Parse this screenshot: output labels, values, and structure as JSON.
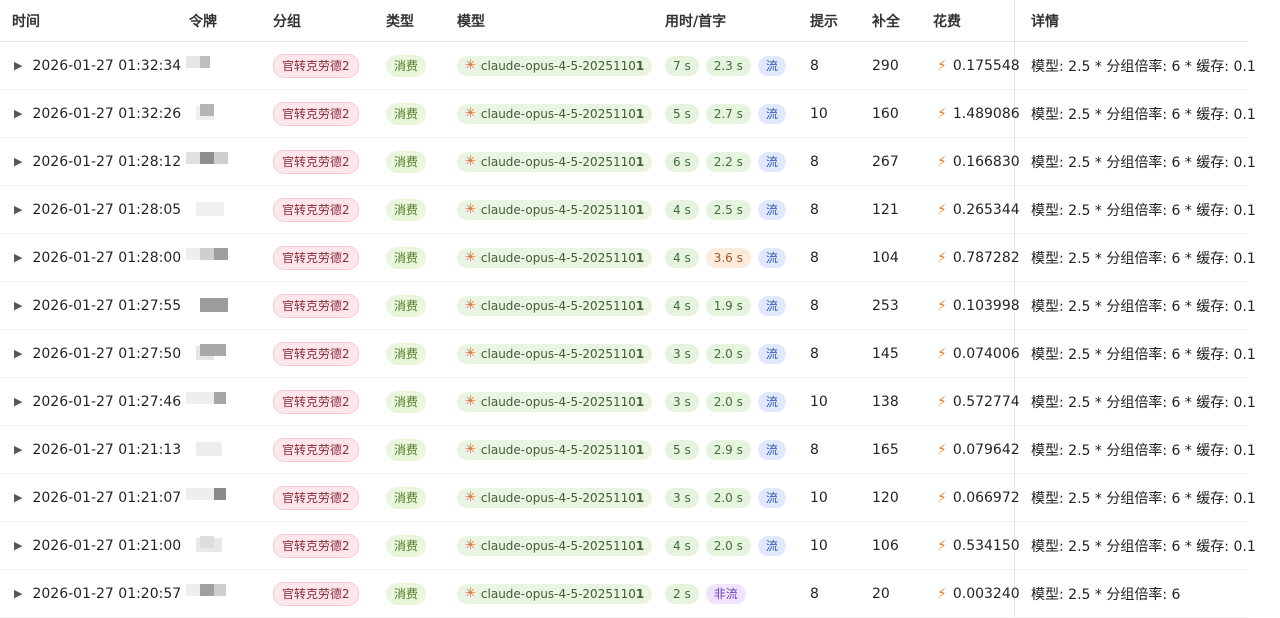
{
  "headers": {
    "time": "时间",
    "token": "令牌",
    "group": "分组",
    "type": "类型",
    "model": "模型",
    "usetime": "用时/首字",
    "prompt": "提示",
    "completion": "补全",
    "cost": "花费",
    "detail": "详情"
  },
  "rows": [
    {
      "time": "2026-01-27 01:32:34",
      "group": "官转克劳德2",
      "type": "消费",
      "model": "claude-opus-4-5-2025110",
      "model_bold": "1",
      "use": "7 s",
      "first": "2.3 s",
      "first_color": "green",
      "stream": "流",
      "prompt": "8",
      "completion": "290",
      "cost": "0.175548",
      "detail": "模型: 2.5 * 分组倍率: 6 * 缓存: 0.1"
    },
    {
      "time": "2026-01-27 01:32:26",
      "group": "官转克劳德2",
      "type": "消费",
      "model": "claude-opus-4-5-2025110",
      "model_bold": "1",
      "use": "5 s",
      "first": "2.7 s",
      "first_color": "green",
      "stream": "流",
      "prompt": "10",
      "completion": "160",
      "cost": "1.489086",
      "detail": "模型: 2.5 * 分组倍率: 6 * 缓存: 0.1"
    },
    {
      "time": "2026-01-27 01:28:12",
      "group": "官转克劳德2",
      "type": "消费",
      "model": "claude-opus-4-5-2025110",
      "model_bold": "1",
      "use": "6 s",
      "first": "2.2 s",
      "first_color": "green",
      "stream": "流",
      "prompt": "8",
      "completion": "267",
      "cost": "0.166830",
      "detail": "模型: 2.5 * 分组倍率: 6 * 缓存: 0.1"
    },
    {
      "time": "2026-01-27 01:28:05",
      "group": "官转克劳德2",
      "type": "消费",
      "model": "claude-opus-4-5-2025110",
      "model_bold": "1",
      "use": "4 s",
      "first": "2.5 s",
      "first_color": "green",
      "stream": "流",
      "prompt": "8",
      "completion": "121",
      "cost": "0.265344",
      "detail": "模型: 2.5 * 分组倍率: 6 * 缓存: 0.1"
    },
    {
      "time": "2026-01-27 01:28:00",
      "group": "官转克劳德2",
      "type": "消费",
      "model": "claude-opus-4-5-2025110",
      "model_bold": "1",
      "use": "4 s",
      "first": "3.6 s",
      "first_color": "orange",
      "stream": "流",
      "prompt": "8",
      "completion": "104",
      "cost": "0.787282",
      "detail": "模型: 2.5 * 分组倍率: 6 * 缓存: 0.1"
    },
    {
      "time": "2026-01-27 01:27:55",
      "group": "官转克劳德2",
      "type": "消费",
      "model": "claude-opus-4-5-2025110",
      "model_bold": "1",
      "use": "4 s",
      "first": "1.9 s",
      "first_color": "green",
      "stream": "流",
      "prompt": "8",
      "completion": "253",
      "cost": "0.103998",
      "detail": "模型: 2.5 * 分组倍率: 6 * 缓存: 0.1"
    },
    {
      "time": "2026-01-27 01:27:50",
      "group": "官转克劳德2",
      "type": "消费",
      "model": "claude-opus-4-5-2025110",
      "model_bold": "1",
      "use": "3 s",
      "first": "2.0 s",
      "first_color": "green",
      "stream": "流",
      "prompt": "8",
      "completion": "145",
      "cost": "0.074006",
      "detail": "模型: 2.5 * 分组倍率: 6 * 缓存: 0.1"
    },
    {
      "time": "2026-01-27 01:27:46",
      "group": "官转克劳德2",
      "type": "消费",
      "model": "claude-opus-4-5-2025110",
      "model_bold": "1",
      "use": "3 s",
      "first": "2.0 s",
      "first_color": "green",
      "stream": "流",
      "prompt": "10",
      "completion": "138",
      "cost": "0.572774",
      "detail": "模型: 2.5 * 分组倍率: 6 * 缓存: 0.1"
    },
    {
      "time": "2026-01-27 01:21:13",
      "group": "官转克劳德2",
      "type": "消费",
      "model": "claude-opus-4-5-2025110",
      "model_bold": "1",
      "use": "5 s",
      "first": "2.9 s",
      "first_color": "green",
      "stream": "流",
      "prompt": "8",
      "completion": "165",
      "cost": "0.079642",
      "detail": "模型: 2.5 * 分组倍率: 6 * 缓存: 0.1"
    },
    {
      "time": "2026-01-27 01:21:07",
      "group": "官转克劳德2",
      "type": "消费",
      "model": "claude-opus-4-5-2025110",
      "model_bold": "1",
      "use": "3 s",
      "first": "2.0 s",
      "first_color": "green",
      "stream": "流",
      "prompt": "10",
      "completion": "120",
      "cost": "0.066972",
      "detail": "模型: 2.5 * 分组倍率: 6 * 缓存: 0.1"
    },
    {
      "time": "2026-01-27 01:21:00",
      "group": "官转克劳德2",
      "type": "消费",
      "model": "claude-opus-4-5-2025110",
      "model_bold": "1",
      "use": "4 s",
      "first": "2.0 s",
      "first_color": "green",
      "stream": "流",
      "prompt": "10",
      "completion": "106",
      "cost": "0.534150",
      "detail": "模型: 2.5 * 分组倍率: 6 * 缓存: 0.1"
    },
    {
      "time": "2026-01-27 01:20:57",
      "group": "官转克劳德2",
      "type": "消费",
      "model": "claude-opus-4-5-2025110",
      "model_bold": "1",
      "use": "2 s",
      "first": "",
      "first_color": "",
      "stream": "非流",
      "prompt": "8",
      "completion": "20",
      "cost": "0.003240",
      "detail": "模型: 2.5 * 分组倍率: 6"
    }
  ],
  "icons": {
    "expand": "caret-right-icon",
    "model": "claude-asterisk-icon",
    "cost": "lightning-bolt-icon"
  },
  "colors": {
    "group_tag_bg": "#fde7ea",
    "type_tag_bg": "#eaf6dc",
    "stream_tag_bg": "#e0e9fb",
    "nostream_tag_bg": "#efe4fb",
    "slow_first_bg": "#fcebdc"
  }
}
